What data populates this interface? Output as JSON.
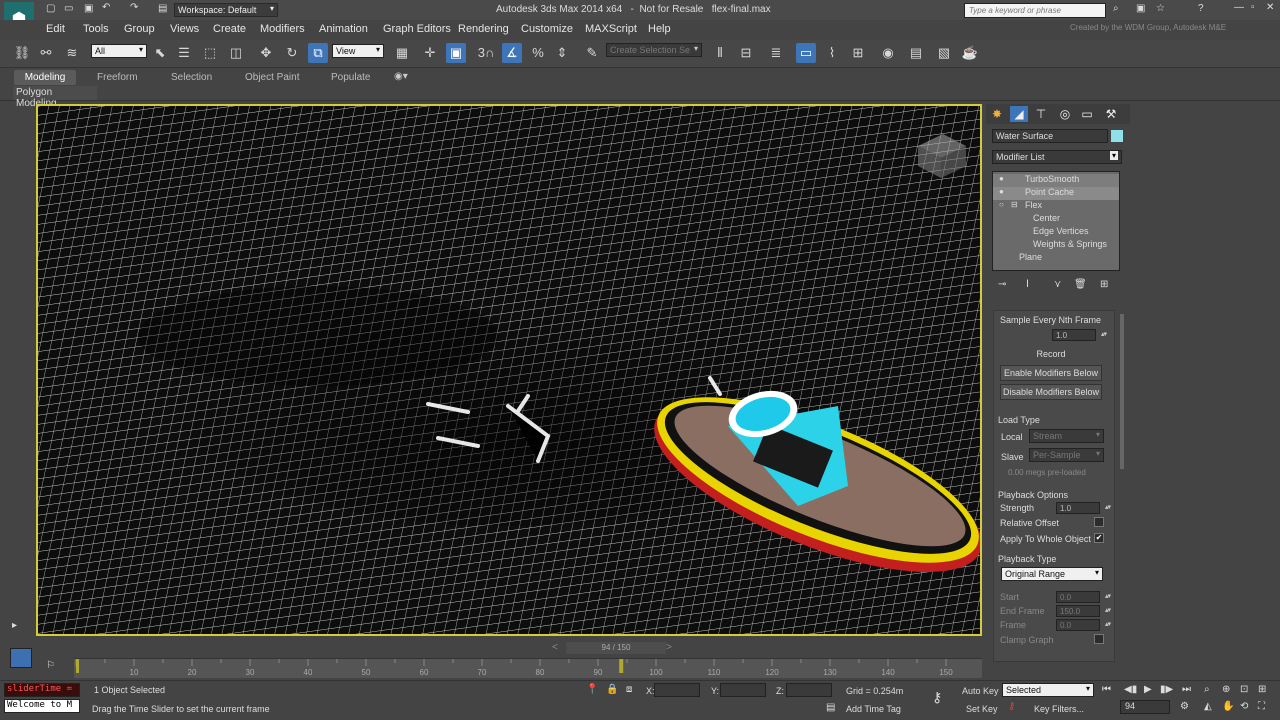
{
  "titlebar": {
    "workspace": "Workspace: Default",
    "title": "Autodesk 3ds Max 2014 x64",
    "license": "Not for Resale",
    "filename": "flex-final.max",
    "search_placeholder": "Type a keyword or phrase",
    "watermark": "Created by the WDM Group, Autodesk M&E"
  },
  "menus": [
    "Edit",
    "Tools",
    "Group",
    "Views",
    "Create",
    "Modifiers",
    "Animation",
    "Graph Editors",
    "Rendering",
    "Customize",
    "MAXScript",
    "Help"
  ],
  "toolbar": {
    "selection_filter": "All",
    "reference_coord": "View",
    "snap_value": "3",
    "selection_set_placeholder": "Create Selection Se"
  },
  "ribbon": {
    "tabs": [
      "Modeling",
      "Freeform",
      "Selection",
      "Object Paint",
      "Populate"
    ],
    "sub_label": "Polygon Modeling"
  },
  "command_panel": {
    "object_name": "Water Surface",
    "object_color": "#8fe0ea",
    "modifier_list": "Modifier List",
    "stack": [
      {
        "label": "TurboSmooth",
        "level": 0
      },
      {
        "label": "Point Cache",
        "level": 0
      },
      {
        "label": "Flex",
        "level": 0
      },
      {
        "label": "Center",
        "level": 1
      },
      {
        "label": "Edge Vertices",
        "level": 1
      },
      {
        "label": "Weights & Springs",
        "level": 1
      },
      {
        "label": "Plane",
        "level": -1
      }
    ],
    "sample_label": "Sample Every Nth Frame",
    "sample_value": "1.0",
    "record_label": "Record",
    "enable_mods": "Enable Modifiers Below",
    "disable_mods": "Disable Modifiers Below",
    "load_type_label": "Load Type",
    "local_label": "Local",
    "local_value": "Stream",
    "slave_label": "Slave",
    "slave_value": "Per-Sample",
    "megs_label": "0.00 megs pre-loaded",
    "playback_options": "Playback Options",
    "strength_label": "Strength",
    "strength_value": "1.0",
    "relative_offset": "Relative Offset",
    "apply_whole": "Apply To Whole Object",
    "playback_type": "Playback Type",
    "playback_type_value": "Original Range",
    "start_label": "Start",
    "start_value": "0.0",
    "end_label": "End Frame",
    "end_value": "150.0",
    "frame_label": "Frame",
    "frame_value": "0.0",
    "clamp_label": "Clamp Graph"
  },
  "timeline": {
    "counter": "94 / 150",
    "current": 94,
    "total": 150,
    "ticks": [
      "10",
      "20",
      "30",
      "40",
      "50",
      "60",
      "70",
      "80",
      "90",
      "100",
      "110",
      "120",
      "130",
      "140",
      "150"
    ]
  },
  "status": {
    "script_label": "sliderTime =",
    "welcome": "Welcome to M",
    "selected": "1 Object Selected",
    "prompt": "Drag the Time Slider to set the current frame",
    "x_label": "X:",
    "y_label": "Y:",
    "z_label": "Z:",
    "grid": "Grid = 0.254m",
    "add_time_tag": "Add Time Tag",
    "auto_key": "Auto Key",
    "key_mode": "Selected",
    "set_key": "Set Key",
    "key_filters": "Key Filters...",
    "frame_field": "94"
  }
}
